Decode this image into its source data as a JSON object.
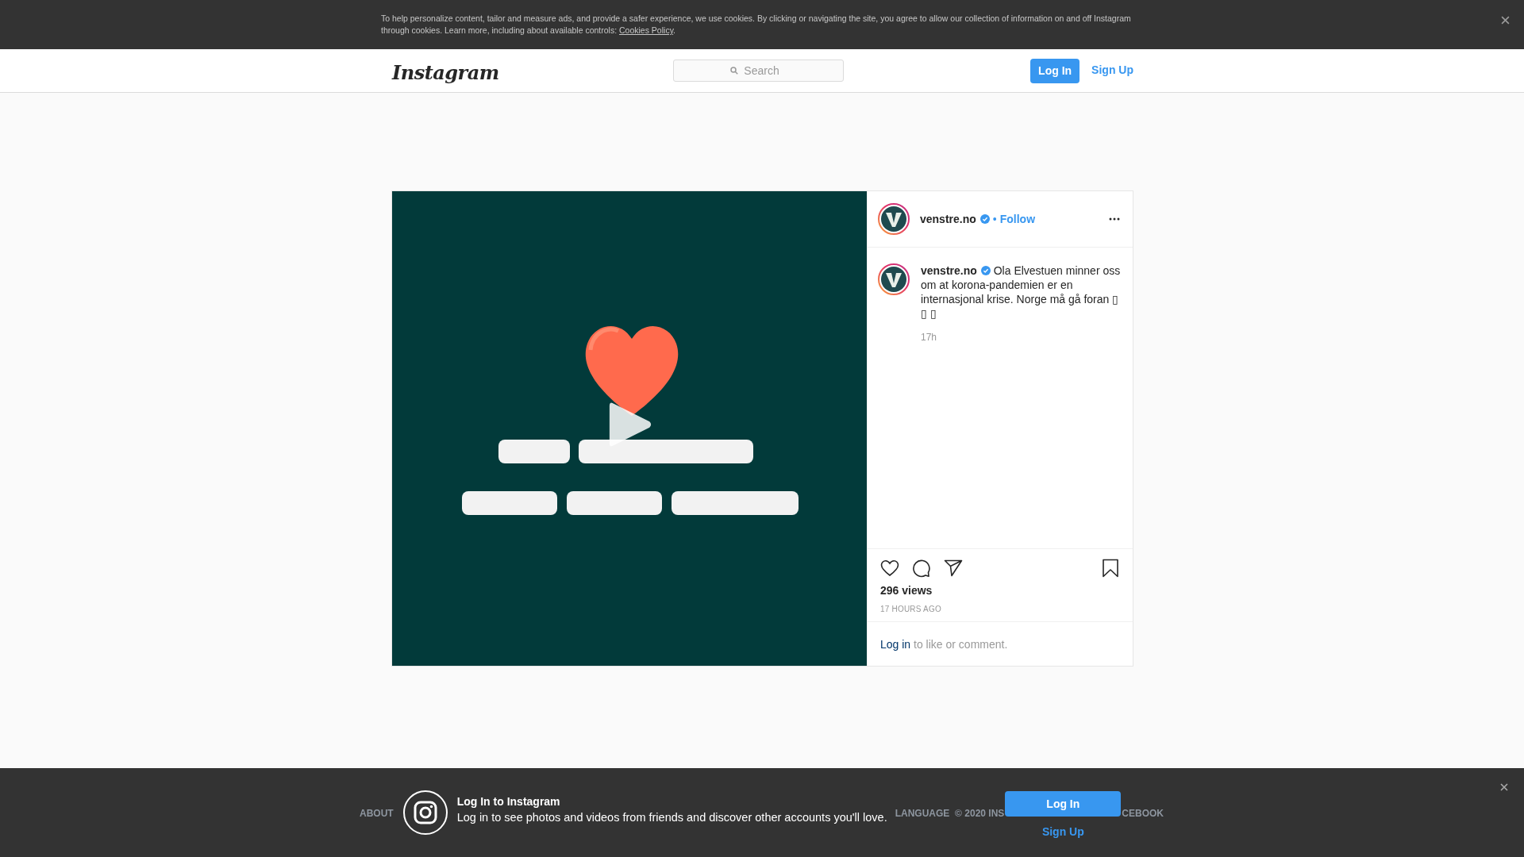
{
  "cookie_banner": {
    "text": "To help personalize content, tailor and measure ads, and provide a safer experience, we use cookies. By clicking or navigating the site, you agree to allow our collection of information on and off Instagram through cookies. Learn more, including about available controls: ",
    "link": "Cookies Policy",
    "end": "."
  },
  "header": {
    "logo": "Instagram",
    "search": {
      "placeholder": "Search"
    },
    "login_button": "Log In",
    "signup_link": "Sign Up"
  },
  "post": {
    "author": {
      "username": "venstre.no",
      "verified": true
    },
    "separator": "•",
    "follow": "Follow",
    "caption": {
      "username": "venstre.no",
      "verified": true,
      "text": "Ola Elvestuen minner oss om at korona-pandemien er en internasjonal krise. Norge må gå foran ▯ ▯ ▯",
      "time": "17h"
    },
    "views": "296 views",
    "date": "17 HOURS AGO",
    "login_prompt": {
      "link": "Log in",
      "text": " to like or comment."
    }
  },
  "footer": {
    "links": [
      "ABOUT",
      "LANGUAGE"
    ],
    "copyright_start": "© 2020 INS",
    "copyright_end": "CEBOOK"
  },
  "login_bar": {
    "title": "Log In to Instagram",
    "subtitle": "Log in to see photos and videos from friends and discover other accounts you'll love.",
    "login_button": "Log In",
    "signup_link": "Sign Up"
  }
}
